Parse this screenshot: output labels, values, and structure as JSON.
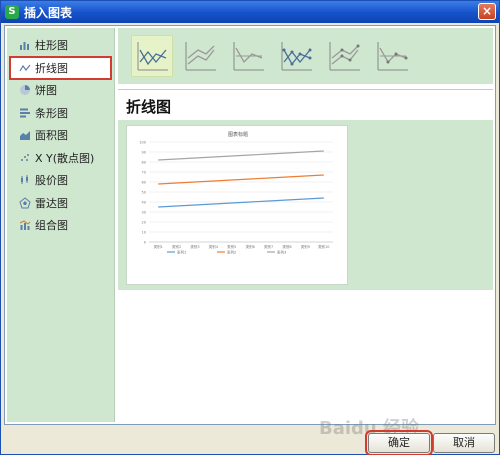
{
  "window": {
    "title": "插入图表",
    "close_label": "×"
  },
  "sidebar": {
    "items": [
      {
        "label": "柱形图",
        "icon": "bar-chart-icon"
      },
      {
        "label": "折线图",
        "icon": "line-chart-icon",
        "active": true
      },
      {
        "label": "饼图",
        "icon": "pie-chart-icon"
      },
      {
        "label": "条形图",
        "icon": "horizontal-bar-icon"
      },
      {
        "label": "面积图",
        "icon": "area-chart-icon"
      },
      {
        "label": "X Y(散点图)",
        "icon": "scatter-chart-icon"
      },
      {
        "label": "股价图",
        "icon": "stock-chart-icon"
      },
      {
        "label": "雷达图",
        "icon": "radar-chart-icon"
      },
      {
        "label": "组合图",
        "icon": "combo-chart-icon"
      }
    ]
  },
  "main": {
    "section_title": "折线图"
  },
  "chart_data": {
    "type": "line",
    "title": "图表标题",
    "ylim": [
      0,
      100
    ],
    "yticks": [
      0,
      10,
      20,
      30,
      40,
      50,
      60,
      70,
      80,
      90,
      100
    ],
    "categories": [
      "类别1",
      "类别2",
      "类别3",
      "类别4",
      "类别5",
      "类别6",
      "类别7",
      "类别8",
      "类别9",
      "类别10"
    ],
    "series": [
      {
        "name": "系列1",
        "color": "#5b9bd5",
        "values": [
          35,
          36,
          37,
          38,
          39,
          40,
          41,
          42,
          43,
          44
        ]
      },
      {
        "name": "系列2",
        "color": "#ed7d31",
        "values": [
          58,
          59,
          60,
          61,
          62,
          63,
          64,
          65,
          66,
          67
        ]
      },
      {
        "name": "系列3",
        "color": "#a5a5a5",
        "values": [
          82,
          83,
          84,
          85,
          86,
          87,
          88,
          89,
          90,
          91
        ]
      }
    ]
  },
  "buttons": {
    "ok": "确定",
    "cancel": "取消"
  },
  "watermark": "Baidu 经验"
}
